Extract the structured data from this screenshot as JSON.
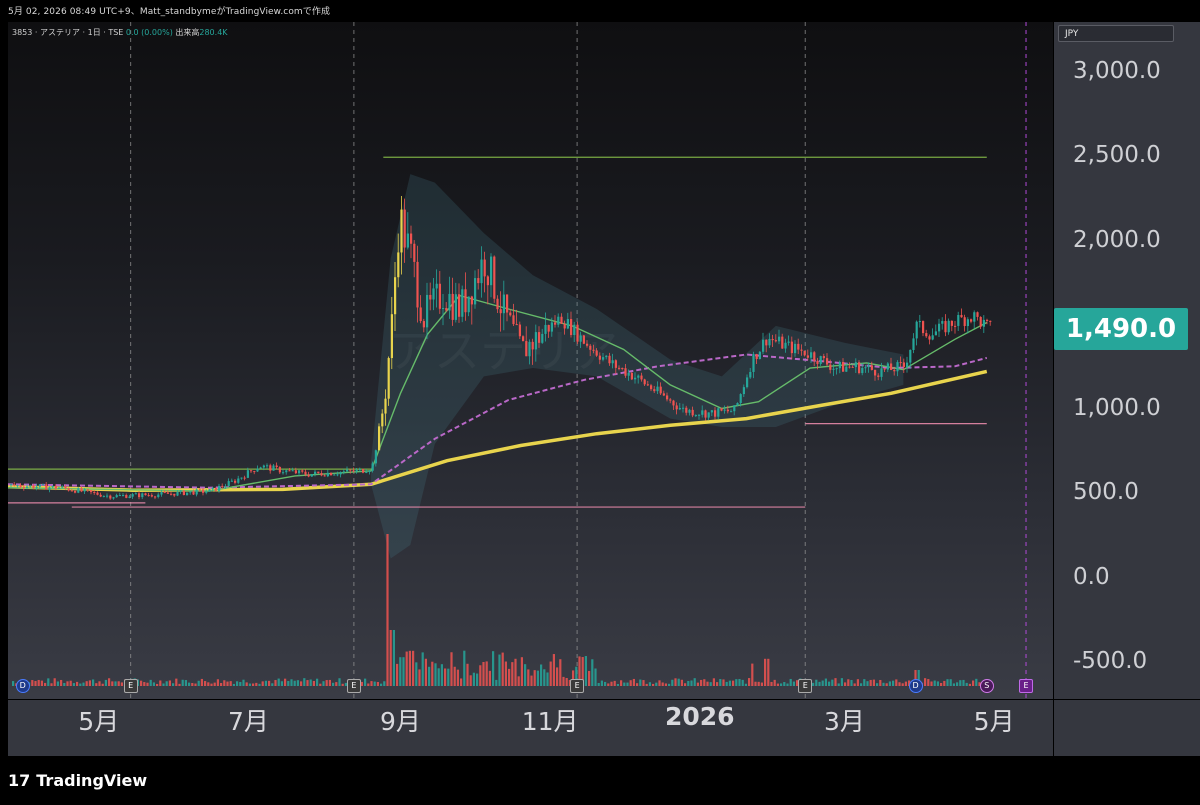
{
  "header": {
    "snapshot_line": "5月 02, 2026 08:49 UTC+9、Matt_standbymeがTradingView.comで作成"
  },
  "legend": {
    "symbol": "3853 · アステリア · 1日 · TSE",
    "change": "0.0 (0.00%)",
    "volume_label": "出来高",
    "volume_value": "280.4K"
  },
  "watermark": "アステリア",
  "currency_button": "JPY",
  "last_price": "1,490.0",
  "brand": {
    "name": "TradingView",
    "logo_glyph": "17"
  },
  "colors": {
    "background": "#000000",
    "up": "#26a69a",
    "down": "#ef5350",
    "ma_short": "#66bb6a",
    "ma_mid": "#ba68c8",
    "ma_long": "#e8d44d",
    "price_badge": "#26a69a"
  },
  "events": [
    {
      "type": "dividend-icon",
      "glyph": "D",
      "date": "2025-03-31"
    },
    {
      "type": "earnings-icon",
      "glyph": "E",
      "date": "2025-05-14"
    },
    {
      "type": "earnings-icon",
      "glyph": "E",
      "date": "2025-08-13"
    },
    {
      "type": "earnings-icon",
      "glyph": "E",
      "date": "2025-11-12"
    },
    {
      "type": "earnings-icon",
      "glyph": "E",
      "date": "2026-02-13"
    },
    {
      "type": "dividend-icon",
      "glyph": "D",
      "date": "2026-03-30"
    },
    {
      "type": "split-icon",
      "glyph": "S",
      "date": "2026-04-28"
    },
    {
      "type": "earnings-icon",
      "glyph": "E",
      "date": "2026-05-14"
    }
  ],
  "chart_data": {
    "type": "candlestick",
    "y_axis": {
      "ticks": [
        "3,000.0",
        "2,500.0",
        "2,000.0",
        "1,500.0",
        "1,000.0",
        "500.0",
        "0.0",
        "-500.0"
      ],
      "tick_values": [
        3000,
        2500,
        2000,
        1500,
        1000,
        500,
        0,
        -500
      ],
      "range": [
        -600,
        3400
      ]
    },
    "x_axis": {
      "ticks": [
        "5月",
        "7月",
        "9月",
        "11月",
        "2026",
        "3月",
        "5月"
      ],
      "tick_dates": [
        "2025-05-01",
        "2025-07-01",
        "2025-09-01",
        "2025-11-01",
        "2026-01-01",
        "2026-03-01",
        "2026-05-01"
      ],
      "bold_ticks": [
        "2026"
      ],
      "range": [
        "2025-03-25",
        "2026-05-25"
      ]
    },
    "grid": true,
    "price_path": [
      [
        "2025-03-25",
        555
      ],
      [
        "2025-04-15",
        540
      ],
      [
        "2025-05-05",
        490
      ],
      [
        "2025-05-25",
        500
      ],
      [
        "2025-06-15",
        520
      ],
      [
        "2025-06-25",
        580
      ],
      [
        "2025-07-05",
        670
      ],
      [
        "2025-07-15",
        640
      ],
      [
        "2025-07-25",
        620
      ],
      [
        "2025-08-05",
        630
      ],
      [
        "2025-08-15",
        640
      ],
      [
        "2025-08-20",
        660
      ],
      [
        "2025-08-25",
        1050
      ],
      [
        "2025-08-28",
        1500
      ],
      [
        "2025-08-31",
        2150
      ],
      [
        "2025-09-05",
        1900
      ],
      [
        "2025-09-10",
        1550
      ],
      [
        "2025-09-18",
        1700
      ],
      [
        "2025-09-25",
        1600
      ],
      [
        "2025-10-05",
        1900
      ],
      [
        "2025-10-12",
        1600
      ],
      [
        "2025-10-20",
        1350
      ],
      [
        "2025-10-28",
        1450
      ],
      [
        "2025-11-05",
        1550
      ],
      [
        "2025-11-15",
        1400
      ],
      [
        "2025-11-25",
        1280
      ],
      [
        "2025-12-05",
        1200
      ],
      [
        "2025-12-15",
        1100
      ],
      [
        "2025-12-25",
        1000
      ],
      [
        "2026-01-05",
        980
      ],
      [
        "2026-01-15",
        1000
      ],
      [
        "2026-01-22",
        1300
      ],
      [
        "2026-01-28",
        1430
      ],
      [
        "2026-02-05",
        1380
      ],
      [
        "2026-02-15",
        1330
      ],
      [
        "2026-02-25",
        1250
      ],
      [
        "2026-03-05",
        1260
      ],
      [
        "2026-03-15",
        1230
      ],
      [
        "2026-03-25",
        1260
      ],
      [
        "2026-03-30",
        1500
      ],
      [
        "2026-04-05",
        1450
      ],
      [
        "2026-04-15",
        1530
      ],
      [
        "2026-04-22",
        1560
      ],
      [
        "2026-04-28",
        1490
      ]
    ],
    "ma_short": [
      [
        "2025-03-25",
        540
      ],
      [
        "2025-06-15",
        520
      ],
      [
        "2025-07-20",
        610
      ],
      [
        "2025-08-20",
        640
      ],
      [
        "2025-09-01",
        1100
      ],
      [
        "2025-09-12",
        1450
      ],
      [
        "2025-09-25",
        1680
      ],
      [
        "2025-10-15",
        1600
      ],
      [
        "2025-11-10",
        1500
      ],
      [
        "2025-12-01",
        1360
      ],
      [
        "2025-12-20",
        1150
      ],
      [
        "2026-01-10",
        1010
      ],
      [
        "2026-01-25",
        1050
      ],
      [
        "2026-02-15",
        1250
      ],
      [
        "2026-03-10",
        1280
      ],
      [
        "2026-03-25",
        1240
      ],
      [
        "2026-04-15",
        1420
      ],
      [
        "2026-04-28",
        1520
      ]
    ],
    "ma_mid": [
      [
        "2025-03-25",
        560
      ],
      [
        "2025-06-15",
        540
      ],
      [
        "2025-08-20",
        560
      ],
      [
        "2025-09-15",
        830
      ],
      [
        "2025-10-15",
        1060
      ],
      [
        "2025-11-15",
        1180
      ],
      [
        "2025-12-15",
        1260
      ],
      [
        "2026-01-20",
        1330
      ],
      [
        "2026-02-20",
        1290
      ],
      [
        "2026-03-20",
        1250
      ],
      [
        "2026-04-15",
        1260
      ],
      [
        "2026-04-28",
        1310
      ]
    ],
    "ma_long": [
      [
        "2025-03-25",
        545
      ],
      [
        "2025-05-15",
        525
      ],
      [
        "2025-07-15",
        530
      ],
      [
        "2025-08-20",
        560
      ],
      [
        "2025-09-20",
        700
      ],
      [
        "2025-10-20",
        790
      ],
      [
        "2025-11-20",
        860
      ],
      [
        "2025-12-20",
        910
      ],
      [
        "2026-01-20",
        950
      ],
      [
        "2026-02-20",
        1030
      ],
      [
        "2026-03-20",
        1100
      ],
      [
        "2026-04-28",
        1230
      ]
    ],
    "band_upper": [
      [
        "2025-08-20",
        700
      ],
      [
        "2025-08-28",
        1900
      ],
      [
        "2025-09-05",
        2400
      ],
      [
        "2025-09-15",
        2350
      ],
      [
        "2025-10-05",
        2050
      ],
      [
        "2025-10-25",
        1800
      ],
      [
        "2025-11-20",
        1600
      ],
      [
        "2025-12-20",
        1300
      ],
      [
        "2026-01-10",
        1200
      ],
      [
        "2026-02-01",
        1500
      ],
      [
        "2026-03-01",
        1400
      ],
      [
        "2026-03-25",
        1330
      ]
    ],
    "band_lower": [
      [
        "2025-08-20",
        560
      ],
      [
        "2025-08-28",
        120
      ],
      [
        "2025-09-05",
        200
      ],
      [
        "2025-09-15",
        800
      ],
      [
        "2025-10-05",
        1200
      ],
      [
        "2025-10-25",
        1250
      ],
      [
        "2025-11-20",
        1200
      ],
      [
        "2025-12-20",
        950
      ],
      [
        "2026-01-10",
        900
      ],
      [
        "2026-02-01",
        900
      ],
      [
        "2026-03-01",
        1050
      ],
      [
        "2026-03-25",
        1150
      ]
    ],
    "levels": [
      {
        "value": 2500,
        "from": "2025-08-25",
        "to": "2026-04-28",
        "color": "#8bc34a"
      },
      {
        "value": 920,
        "from": "2026-02-13",
        "to": "2026-04-28",
        "color": "#f48fb1"
      },
      {
        "value": 650,
        "from": "2025-03-25",
        "to": "2025-08-20",
        "color": "#8bc34a"
      },
      {
        "value": 425,
        "from": "2025-04-20",
        "to": "2026-02-13",
        "color": "#f48fb1"
      },
      {
        "value": 450,
        "from": "2025-03-25",
        "to": "2025-05-20",
        "color": "#f48fb1"
      }
    ],
    "vertical_markers": [
      "2025-05-14",
      "2025-08-13",
      "2025-11-12",
      "2026-02-13"
    ],
    "volume_spikes": [
      [
        "2025-08-26",
        0.95
      ],
      [
        "2025-08-28",
        0.35
      ],
      [
        "2025-09-01",
        0.18
      ],
      [
        "2025-09-05",
        0.22
      ],
      [
        "2025-09-12",
        0.12
      ],
      [
        "2025-10-05",
        0.15
      ],
      [
        "2025-10-20",
        0.18
      ],
      [
        "2025-11-01",
        0.12
      ],
      [
        "2026-01-22",
        0.14
      ],
      [
        "2026-01-28",
        0.17
      ],
      [
        "2026-03-30",
        0.1
      ]
    ]
  }
}
